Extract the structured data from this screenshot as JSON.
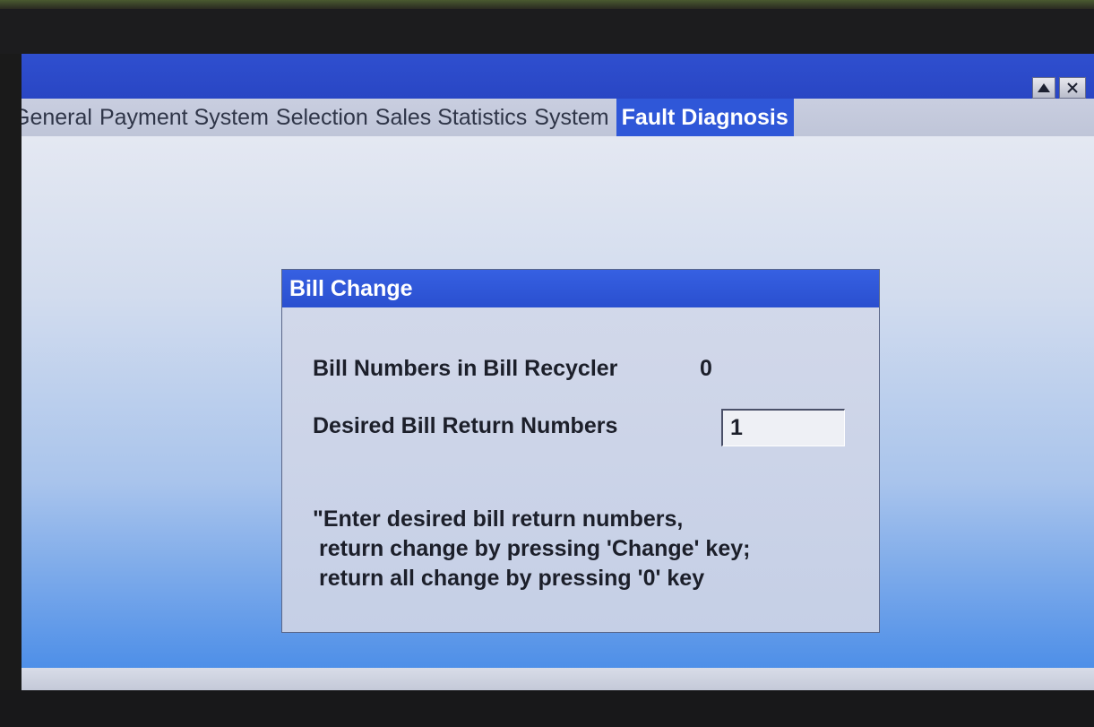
{
  "window": {
    "scroll_up_icon": "triangle-up-icon",
    "close_icon": "close-icon"
  },
  "tabs": [
    {
      "label": "General",
      "active": false
    },
    {
      "label": "Payment System",
      "active": false
    },
    {
      "label": "Selection",
      "active": false
    },
    {
      "label": "Sales Statistics",
      "active": false
    },
    {
      "label": "System",
      "active": false
    },
    {
      "label": "Fault Diagnosis",
      "active": true
    }
  ],
  "dialog": {
    "title": "Bill Change",
    "recycler_label": "Bill Numbers in Bill Recycler",
    "recycler_count": "0",
    "desired_label": "Desired Bill Return Numbers",
    "desired_value": "1",
    "hint_lines": [
      "\"Enter desired bill return numbers,",
      "return change by pressing 'Change' key;",
      "return all change by pressing '0' key"
    ]
  },
  "colors": {
    "titlebar": "#2946c4",
    "active_tab": "#2f57d8",
    "dialog_title": "#2a4fcf"
  }
}
